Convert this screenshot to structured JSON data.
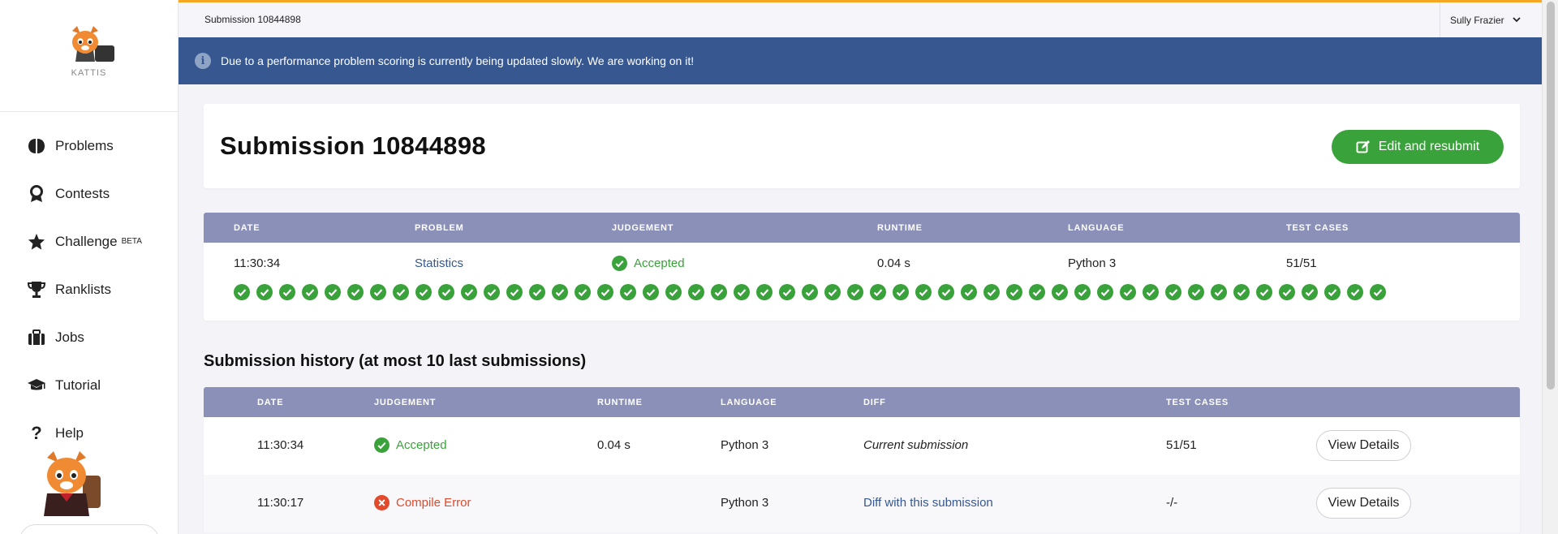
{
  "brand": {
    "label": "KATTIS"
  },
  "sidebar": {
    "items": [
      {
        "label": "Problems",
        "icon": "brain-icon"
      },
      {
        "label": "Contests",
        "icon": "award-icon"
      },
      {
        "label": "Challenge",
        "icon": "star-icon",
        "badge": "BETA"
      },
      {
        "label": "Ranklists",
        "icon": "trophy-icon"
      },
      {
        "label": "Jobs",
        "icon": "briefcase-icon"
      },
      {
        "label": "Tutorial",
        "icon": "graduation-cap-icon"
      },
      {
        "label": "Help",
        "icon": "question-icon"
      }
    ]
  },
  "topbar": {
    "breadcrumb": "Submission 10844898",
    "user": "Sully Frazier"
  },
  "banner": {
    "message": "Due to a performance problem scoring is currently being updated slowly. We are working on it!"
  },
  "header": {
    "title": "Submission 10844898",
    "edit_button": "Edit and resubmit"
  },
  "submission": {
    "headers": {
      "date": "DATE",
      "problem": "PROBLEM",
      "judgement": "JUDGEMENT",
      "runtime": "RUNTIME",
      "language": "LANGUAGE",
      "test_cases": "TEST CASES"
    },
    "row": {
      "date": "11:30:34",
      "problem": "Statistics",
      "judgement": "Accepted",
      "runtime": "0.04 s",
      "language": "Python 3",
      "test_cases": "51/51"
    },
    "passed_test_cases": 51
  },
  "history": {
    "title": "Submission history (at most 10 last submissions)",
    "headers": {
      "date": "DATE",
      "judgement": "JUDGEMENT",
      "runtime": "RUNTIME",
      "language": "LANGUAGE",
      "diff": "DIFF",
      "test_cases": "TEST CASES"
    },
    "rows": [
      {
        "date": "11:30:34",
        "judgement": "Accepted",
        "runtime": "0.04 s",
        "language": "Python 3",
        "diff": "Current submission",
        "test_cases": "51/51",
        "button": "View Details"
      },
      {
        "date": "11:30:17",
        "judgement": "Compile Error",
        "runtime": "",
        "language": "Python 3",
        "diff": "Diff with this submission",
        "test_cases": "-/-",
        "button": "View Details"
      }
    ]
  },
  "colors": {
    "accent_green": "#3aa23a",
    "banner_blue": "#36578f",
    "table_header": "#8b90b8",
    "error_red": "#e24a2b",
    "topbar_accent": "#f5a623"
  }
}
